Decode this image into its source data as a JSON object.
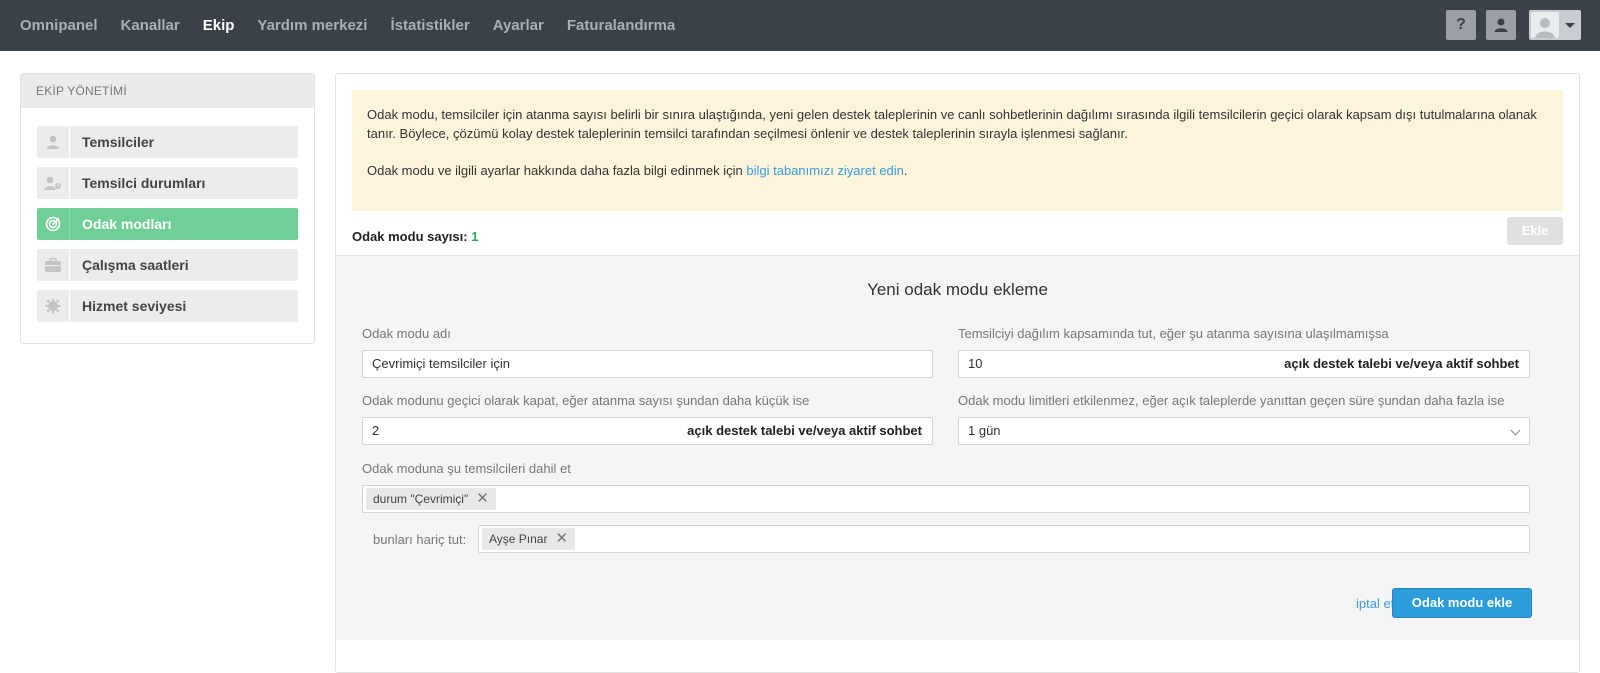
{
  "nav": {
    "items": [
      {
        "label": "Omnipanel",
        "active": false
      },
      {
        "label": "Kanallar",
        "active": false
      },
      {
        "label": "Ekip",
        "active": true
      },
      {
        "label": "Yardım merkezi",
        "active": false
      },
      {
        "label": "İstatistikler",
        "active": false
      },
      {
        "label": "Ayarlar",
        "active": false
      },
      {
        "label": "Faturalandırma",
        "active": false
      }
    ],
    "help_label": "?"
  },
  "sidebar": {
    "heading": "EKİP YÖNETİMİ",
    "items": [
      {
        "label": "Temsilciler",
        "icon": "user-icon",
        "active": false
      },
      {
        "label": "Temsilci durumları",
        "icon": "user-status-icon",
        "active": false
      },
      {
        "label": "Odak modları",
        "icon": "target-icon",
        "active": true
      },
      {
        "label": "Çalışma saatleri",
        "icon": "briefcase-icon",
        "active": false
      },
      {
        "label": "Hizmet seviyesi",
        "icon": "gear-icon",
        "active": false
      }
    ]
  },
  "notice": {
    "paragraph1": "Odak modu, temsilciler için atanma sayısı belirli bir sınıra ulaştığında, yeni gelen destek taleplerinin ve canlı sohbetlerinin dağılımı sırasında ilgili temsilcilerin geçici olarak kapsam dışı tutulmalarına olanak tanır. Böylece, çözümü kolay destek taleplerinin temsilci tarafından seçilmesi önlenir ve destek taleplerinin sırayla işlenmesi sağlanır.",
    "paragraph2_prefix": "Odak modu ve ilgili ayarlar hakkında daha fazla bilgi edinmek için ",
    "paragraph2_link": "bilgi tabanımızı ziyaret edin",
    "paragraph2_suffix": "."
  },
  "count": {
    "label": "Odak modu sayısı: ",
    "value": "1",
    "add_button": "Ekle"
  },
  "form": {
    "title": "Yeni odak modu ekleme",
    "name_label": "Odak modu adı",
    "name_value": "Çevrimiçi temsilciler için",
    "keep_label": "Temsilciyi dağılım kapsamında tut, eğer şu atanma sayısına ulaşılmamışsa",
    "keep_value": "10",
    "keep_suffix": "açık destek talebi ve/veya aktif sohbet",
    "close_label": "Odak modunu geçici olarak kapat, eğer atanma sayısı şundan daha küçük ise",
    "close_value": "2",
    "close_suffix": "açık destek talebi ve/veya aktif sohbet",
    "limit_label": "Odak modu limitleri etkilenmez, eğer açık taleplerde yanıttan geçen süre şundan daha fazla ise",
    "limit_value": "1 gün",
    "include_label": "Odak moduna şu temsilcileri dahil et",
    "include_tag": "durum \"Çevrimiçi\"",
    "exclude_label": "bunları hariç tut:",
    "exclude_tag": "Ayşe Pınar",
    "tag_remove": "✕",
    "cancel_label": "iptal et",
    "submit_label": "Odak modu ekle"
  }
}
